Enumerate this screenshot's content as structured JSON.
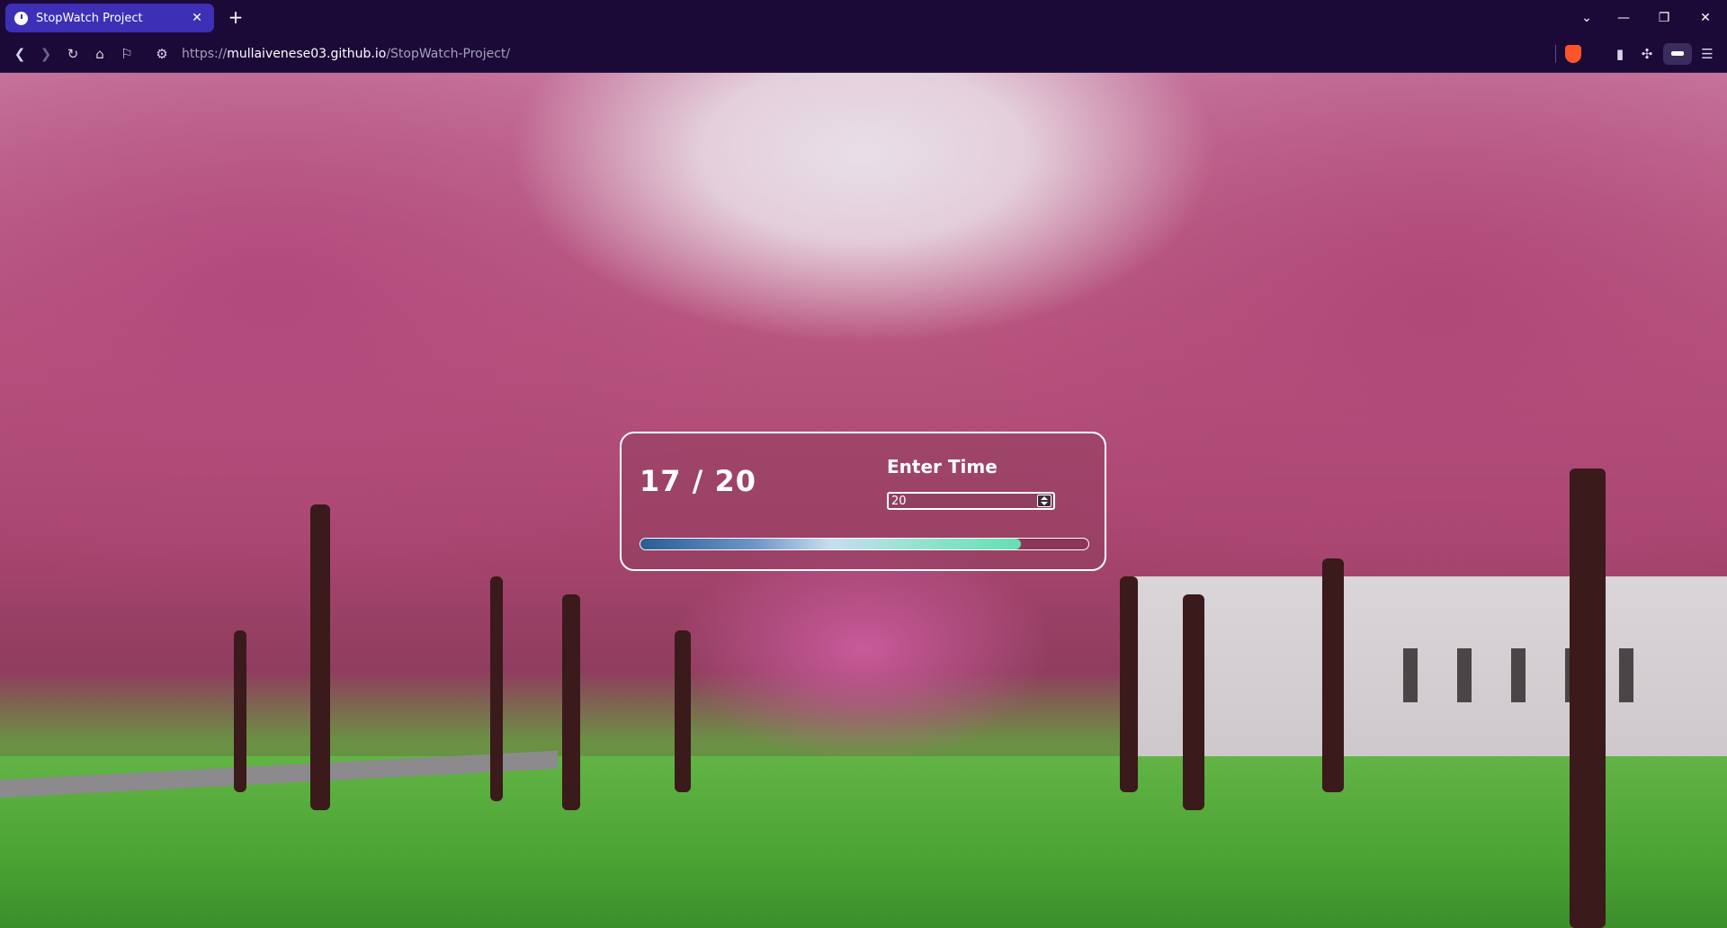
{
  "browser": {
    "tab": {
      "title": "StopWatch Project",
      "close_label": "✕"
    },
    "new_tab_label": "+",
    "url": {
      "scheme": "https://",
      "host": "mullaivenese03.github.io",
      "path": "/StopWatch-Project/"
    },
    "window_controls": {
      "dropdown": "⌄",
      "minimize": "—",
      "restore": "❐",
      "close": "✕"
    }
  },
  "stopwatch": {
    "display": "17 / 20",
    "input_label": "Enter Time",
    "input_value": "20",
    "progress_fraction": 0.85
  }
}
